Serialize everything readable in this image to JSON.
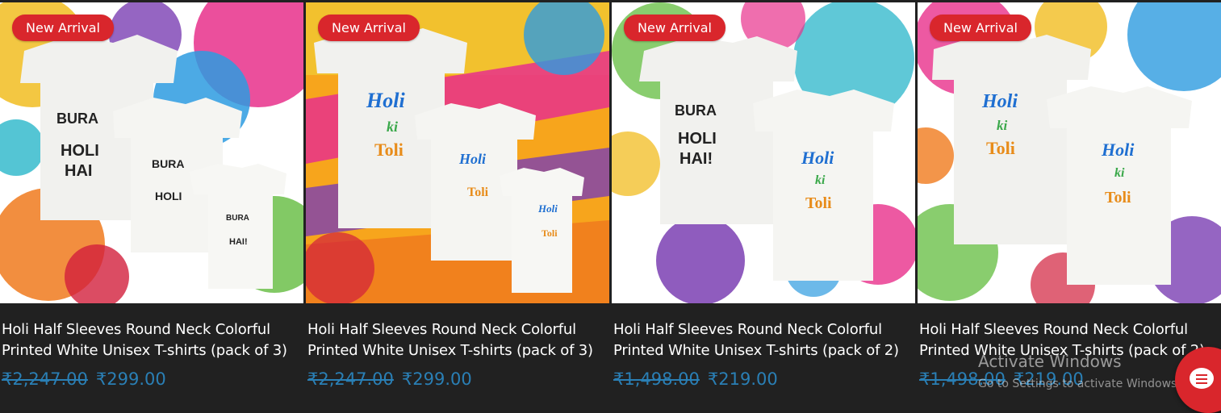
{
  "products": [
    {
      "badge": "New Arrival",
      "title_line1": "Holi Half Sleeves Round Neck Colorful",
      "title_line2": "Printed White Unisex T-shirts (pack of 3)",
      "old_price": "₹2,247.00",
      "price": "₹299.00",
      "image": "three-white-tshirts-bura-na-mano-holi-hai"
    },
    {
      "badge": "New Arrival",
      "title_line1": "Holi Half Sleeves Round Neck Colorful",
      "title_line2": "Printed White Unisex T-shirts (pack of 3)",
      "old_price": "₹2,247.00",
      "price": "₹299.00",
      "image": "three-white-tshirts-holi-ki-toli"
    },
    {
      "badge": "New Arrival",
      "title_line1": "Holi Half Sleeves Round Neck Colorful",
      "title_line2": "Printed White Unisex T-shirts (pack of 2)",
      "old_price": "₹1,498.00",
      "price": "₹219.00",
      "image": "two-white-tshirts-bura-na-mano-and-holi-ki-toli"
    },
    {
      "badge": "New Arrival",
      "title_line1": "Holi Half Sleeves Round Neck Colorful",
      "title_line2": "Printed White Unisex T-shirts (pack of 2)",
      "old_price": "₹1,498.00",
      "price": "₹219.00",
      "image": "two-white-tshirts-holi-ki-toli"
    }
  ],
  "watermark": {
    "title": "Activate Windows",
    "subtitle": "Go to Settings to activate Windows."
  },
  "chat_button": {
    "icon": "chat-icon"
  },
  "colors": {
    "badge": "#d9262c",
    "price": "#2a7fb5",
    "background": "#212121"
  }
}
